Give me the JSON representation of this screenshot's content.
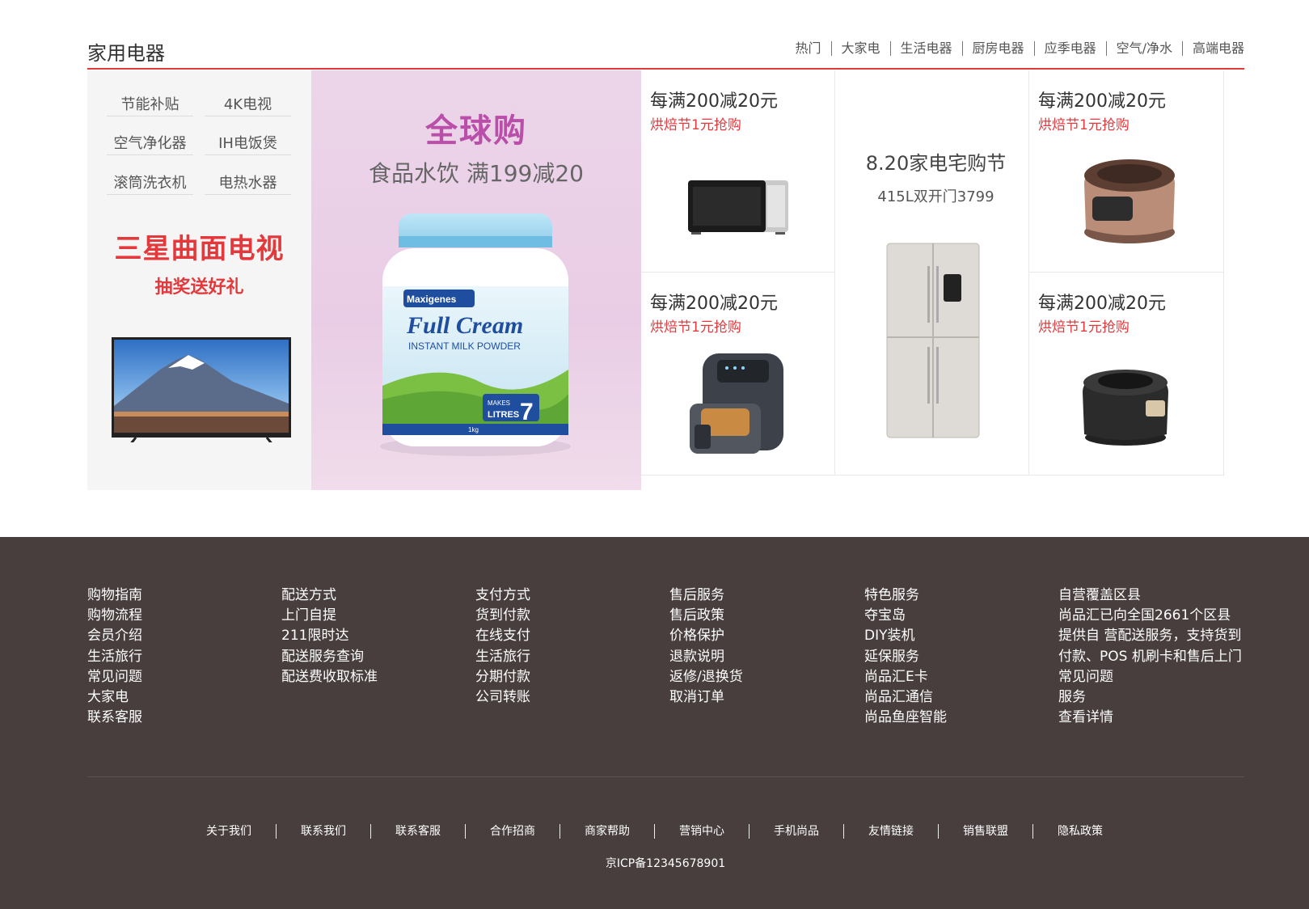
{
  "floor": {
    "title": "家用电器",
    "tabs": [
      "热门",
      "大家电",
      "生活电器",
      "厨房电器",
      "应季电器",
      "空气/净水",
      "高端电器"
    ]
  },
  "left_panel": {
    "keywords": [
      "节能补贴",
      "4K电视",
      "空气净化器",
      "IH电饭煲",
      "滚筒洗衣机",
      "电热水器"
    ],
    "promo_title": "三星曲面电视",
    "promo_sub": "抽奖送好礼"
  },
  "banner": {
    "title": "全球购",
    "subtitle": "食品水饮  满199减20",
    "product_brand": "Maxigenes",
    "product_name": "Full Cream",
    "product_desc": "INSTANT MILK POWDER",
    "product_badge_top": "MAKES",
    "product_badge_bottom": "LITRES",
    "product_badge_num": "7",
    "product_weight": "1kg"
  },
  "cells": [
    {
      "title": "每满200减20元",
      "sub": "烘焙节1元抢购",
      "icon": "microwave-oven"
    },
    {
      "title": "每满200减20元",
      "sub": "烘焙节1元抢购",
      "icon": "air-fryer"
    },
    {
      "title": "每满200减20元",
      "sub": "烘焙节1元抢购",
      "icon": "rice-cooker-bronze"
    },
    {
      "title": "每满200减20元",
      "sub": "烘焙节1元抢购",
      "icon": "rice-cooker-black"
    }
  ],
  "center_cell": {
    "title": "8.20家电宅购节",
    "sub": "415L双开门3799",
    "icon": "refrigerator"
  },
  "footer": {
    "columns": [
      [
        "购物指南",
        "购物流程",
        "会员介绍",
        "生活旅行",
        "常见问题",
        "大家电",
        "联系客服"
      ],
      [
        "配送方式",
        "上门自提",
        "211限时达",
        "配送服务查询",
        "配送费收取标准"
      ],
      [
        "支付方式",
        "货到付款",
        "在线支付",
        "生活旅行",
        "分期付款",
        "公司转账"
      ],
      [
        "售后服务",
        "售后政策",
        "价格保护",
        "退款说明",
        "返修/退换货",
        "取消订单"
      ],
      [
        "特色服务",
        "夺宝岛",
        "DIY装机",
        "延保服务",
        "尚品汇E卡",
        "尚品汇通信",
        "尚品鱼座智能"
      ],
      [
        "自营覆盖区县",
        "尚品汇已向全国2661个区县",
        "提供自 营配送服务，支持货到",
        "付款、POS 机刷卡和售后上门",
        "常见问题",
        "服务",
        "查看详情"
      ]
    ],
    "links": [
      "关于我们",
      "联系我们",
      "联系客服",
      "合作招商",
      "商家帮助",
      "营销中心",
      "手机尚品",
      "友情链接",
      "销售联盟",
      "隐私政策"
    ],
    "icp": "京ICP备12345678901"
  },
  "colors": {
    "accent": "#e4393c",
    "footer_bg": "#473e3d",
    "banner_bg": "#ecd5e9",
    "banner_title": "#b94fa9"
  }
}
